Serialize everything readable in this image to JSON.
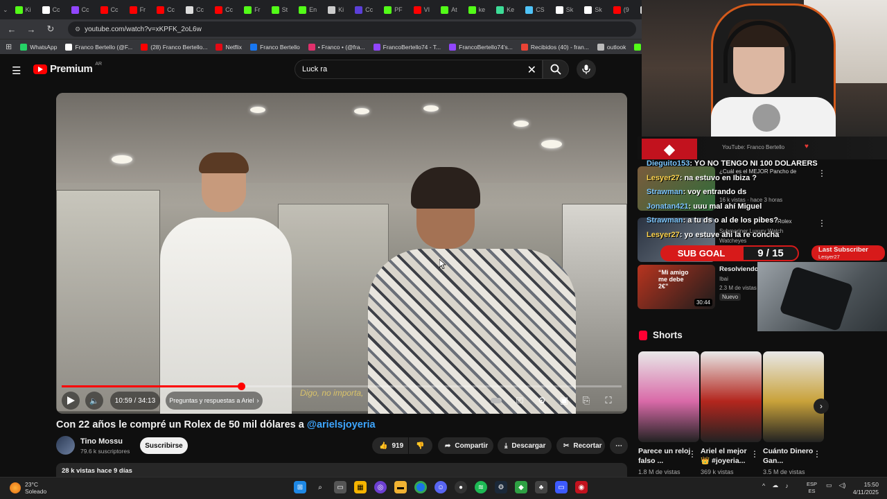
{
  "browser": {
    "tabs": [
      {
        "label": "Ki",
        "color": "#53fc18"
      },
      {
        "label": "Cc",
        "color": "#ffffff"
      },
      {
        "label": "Cc",
        "color": "#9146ff"
      },
      {
        "label": "Cc",
        "color": "#ff0000"
      },
      {
        "label": "Fr",
        "color": "#ff0000"
      },
      {
        "label": "Cc",
        "color": "#ff0000"
      },
      {
        "label": "Cc",
        "color": "#dddddd"
      },
      {
        "label": "Cc",
        "color": "#ff0000"
      },
      {
        "label": "Fr",
        "color": "#53fc18"
      },
      {
        "label": "St",
        "color": "#53fc18"
      },
      {
        "label": "En",
        "color": "#53fc18"
      },
      {
        "label": "Ki",
        "color": "#cccccc"
      },
      {
        "label": "Cc",
        "color": "#5b3fd8"
      },
      {
        "label": "PF",
        "color": "#53fc18"
      },
      {
        "label": "VI",
        "color": "#ff0000"
      },
      {
        "label": "At",
        "color": "#53fc18"
      },
      {
        "label": "ke",
        "color": "#53fc18"
      },
      {
        "label": "Ke",
        "color": "#3ddc97"
      },
      {
        "label": "CS",
        "color": "#4fc3f7"
      },
      {
        "label": "Sk",
        "color": "#ffffff"
      },
      {
        "label": "Sk",
        "color": "#ffffff"
      },
      {
        "label": "(9",
        "color": "#ff0000"
      },
      {
        "label": "(1",
        "color": "#dddddd"
      }
    ],
    "url": "youtube.com/watch?v=xKPFK_2oL6w",
    "bookmarks": [
      {
        "label": "WhatsApp",
        "color": "#25d366"
      },
      {
        "label": "Franco Bertello (@F...",
        "color": "#ffffff"
      },
      {
        "label": "(28) Franco Bertello...",
        "color": "#ff0000"
      },
      {
        "label": "Netflix",
        "color": "#e50914"
      },
      {
        "label": "Franco Bertello",
        "color": "#1877f2"
      },
      {
        "label": "• Franco • (@fra...",
        "color": "#e1306c"
      },
      {
        "label": "FrancoBertello74 - T...",
        "color": "#9146ff"
      },
      {
        "label": "FrancoBertello74's...",
        "color": "#9146ff"
      },
      {
        "label": "Recibidos (40) - fran...",
        "color": "#ea4335"
      },
      {
        "label": "outlook",
        "color": "#bbbbbb"
      },
      {
        "label": "Aler",
        "color": "#53fc18"
      }
    ]
  },
  "youtube": {
    "brand": "Premium",
    "country": "AR",
    "search_value": "Luck ra",
    "player": {
      "current_time": "10:59",
      "duration": "34:13",
      "time_display": "10:59 / 34:13",
      "chapter": "Preguntas y respuestas a Ariel",
      "subtitle": "Digo, no importa,",
      "progress": 0.321
    },
    "video": {
      "title": "Con 22 años le compré un Rolex de 50 mil dólares a ",
      "mention": "@arielsjoyeria",
      "channel": "Tino Mossu",
      "subscribers": "79.6 k suscriptores",
      "subscribe_label": "Suscribirse",
      "likes": "919",
      "share_label": "Compartir",
      "download_label": "Descargar",
      "clip_label": "Recortar",
      "views_line": "28 k vistas  hace 9 días"
    }
  },
  "stream_overlay": {
    "channel_label": "YouTube: Franco Bertello",
    "chat": [
      {
        "user": "Dieguito153",
        "text": ": YO NO TENGO NI 100 DOLARERS",
        "color": "#7ec8ff"
      },
      {
        "user": "Lesyer27",
        "text": ": na estuvo en Ibiza ?",
        "color": "#ffd54f"
      },
      {
        "user": "Strawman",
        "text": ": voy entrando ds",
        "color": "#7ec8ff"
      },
      {
        "user": "Jonatan421",
        "text": ": uuu mal ahí Miguel",
        "color": "#7ec8ff"
      },
      {
        "user": "Strawman",
        "text": ": a tu ds o al de los pibes?",
        "color": "#7ec8ff"
      },
      {
        "user": "Lesyer27",
        "text": ": yo estuve ahi la re concha",
        "color": "#ffd54f"
      }
    ],
    "rec_bits": {
      "r1_title": "¿Cuál es el MEJOR Pancho de",
      "r1_meta": "16 k vistas · hace 3 horas",
      "r2_title": "Rolex",
      "r2_sub": "Submariner Luxury Watch",
      "r2_meta": "Watcheyes",
      "r3_title": "Resolviendo",
      "r3_channel": "Ibai",
      "r3_meta": "2.3 M de vistas",
      "r3_badge": "Nuevo",
      "r3_duration": "30:44",
      "r3_thumb_text": "“Mi amigo me debe 2€”"
    },
    "sub_goal_label": "SUB GOAL",
    "sub_goal_value": "9 / 15",
    "sub_goal_current": 9,
    "sub_goal_target": 15,
    "last_sub_label": "Last Subscriber",
    "last_sub_name": "Lesyer27"
  },
  "shorts": {
    "header": "Shorts",
    "items": [
      {
        "title": "Parece un reloj falso ...",
        "views": "1.8 M de vistas",
        "color": "#d96aa8"
      },
      {
        "title": "Ariel el mejor 👑 #joyeria...",
        "views": "369 k vistas",
        "color": "#b3261e"
      },
      {
        "title": "Cuánto Dinero Gan...",
        "views": "3.5 M de vistas",
        "color": "#c9a23a"
      }
    ]
  },
  "taskbar": {
    "temperature": "23°C",
    "weather": "Soleado",
    "lang_top": "ESP",
    "lang_bottom": "ES",
    "time": "15:50",
    "date": "4/11/2025"
  }
}
